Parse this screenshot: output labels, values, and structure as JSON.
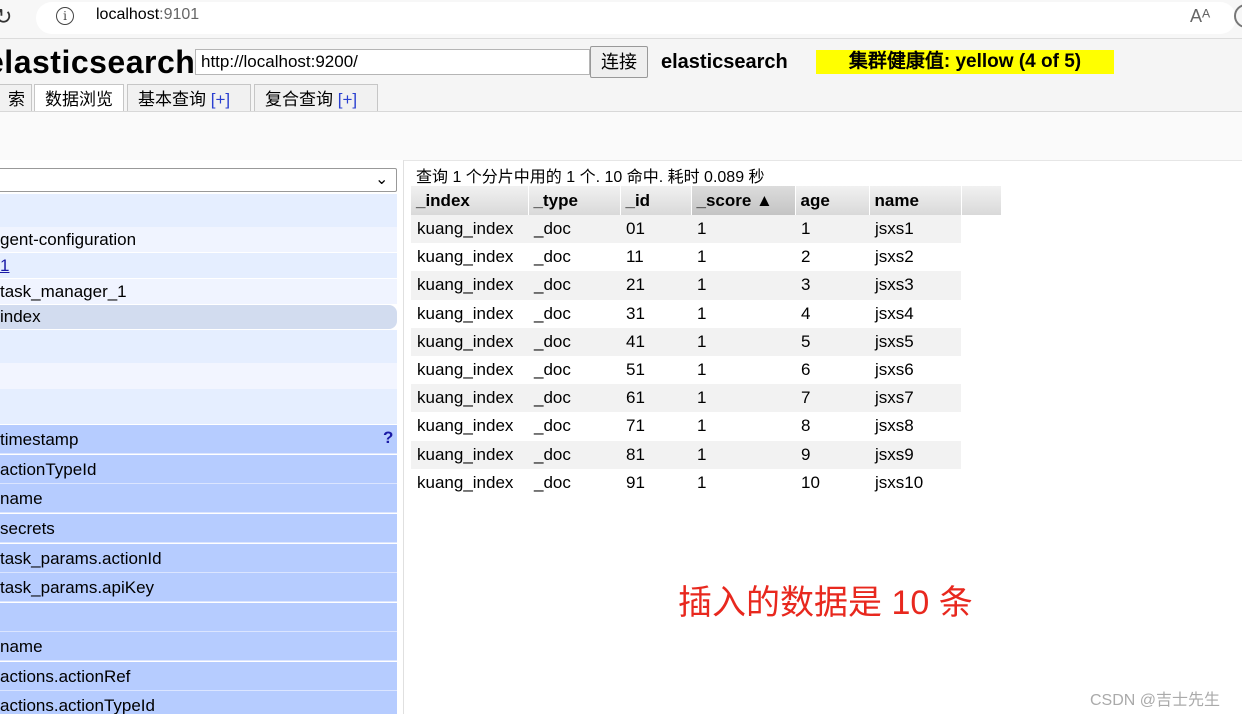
{
  "browser": {
    "url_host": "localhost",
    "url_port": ":9101",
    "info_glyph": "i"
  },
  "header": {
    "app_title": "elasticsearch",
    "server_url": "http://localhost:9200/",
    "connect_label": "连接",
    "cluster_name": "elasticsearch",
    "health_label": "集群健康值: yellow (4 of 5)",
    "health_color": "#ffff00"
  },
  "tabs": [
    {
      "label": "索引",
      "plus": ""
    },
    {
      "label": "数据浏览",
      "plus": ""
    },
    {
      "label": "基本查询 ",
      "plus": "[+]"
    },
    {
      "label": "复合查询 ",
      "plus": "[+]"
    }
  ],
  "sidebar": {
    "indices": [
      "gent-configuration",
      "1",
      "task_manager_1",
      "index"
    ],
    "fields": [
      "timestamp",
      "actionTypeId",
      "name",
      "secrets",
      "task_params.actionId",
      "task_params.apiKey",
      "",
      "name",
      "actions.actionRef",
      "actions.actionTypeId"
    ],
    "help": "?"
  },
  "results": {
    "summary": "查询 1 个分片中用的 1 个. 10 命中. 耗时 0.089 秒",
    "columns": [
      "_index",
      "_type",
      "_id",
      "_score ▲",
      "age",
      "name"
    ],
    "rows": [
      [
        "kuang_index",
        "_doc",
        "01",
        "1",
        "1",
        "jsxs1"
      ],
      [
        "kuang_index",
        "_doc",
        "11",
        "1",
        "2",
        "jsxs2"
      ],
      [
        "kuang_index",
        "_doc",
        "21",
        "1",
        "3",
        "jsxs3"
      ],
      [
        "kuang_index",
        "_doc",
        "31",
        "1",
        "4",
        "jsxs4"
      ],
      [
        "kuang_index",
        "_doc",
        "41",
        "1",
        "5",
        "jsxs5"
      ],
      [
        "kuang_index",
        "_doc",
        "51",
        "1",
        "6",
        "jsxs6"
      ],
      [
        "kuang_index",
        "_doc",
        "61",
        "1",
        "7",
        "jsxs7"
      ],
      [
        "kuang_index",
        "_doc",
        "71",
        "1",
        "8",
        "jsxs8"
      ],
      [
        "kuang_index",
        "_doc",
        "81",
        "1",
        "9",
        "jsxs9"
      ],
      [
        "kuang_index",
        "_doc",
        "91",
        "1",
        "10",
        "jsxs10"
      ]
    ]
  },
  "annotation": "插入的数据是 10 条",
  "watermark": "CSDN @吉士先生"
}
